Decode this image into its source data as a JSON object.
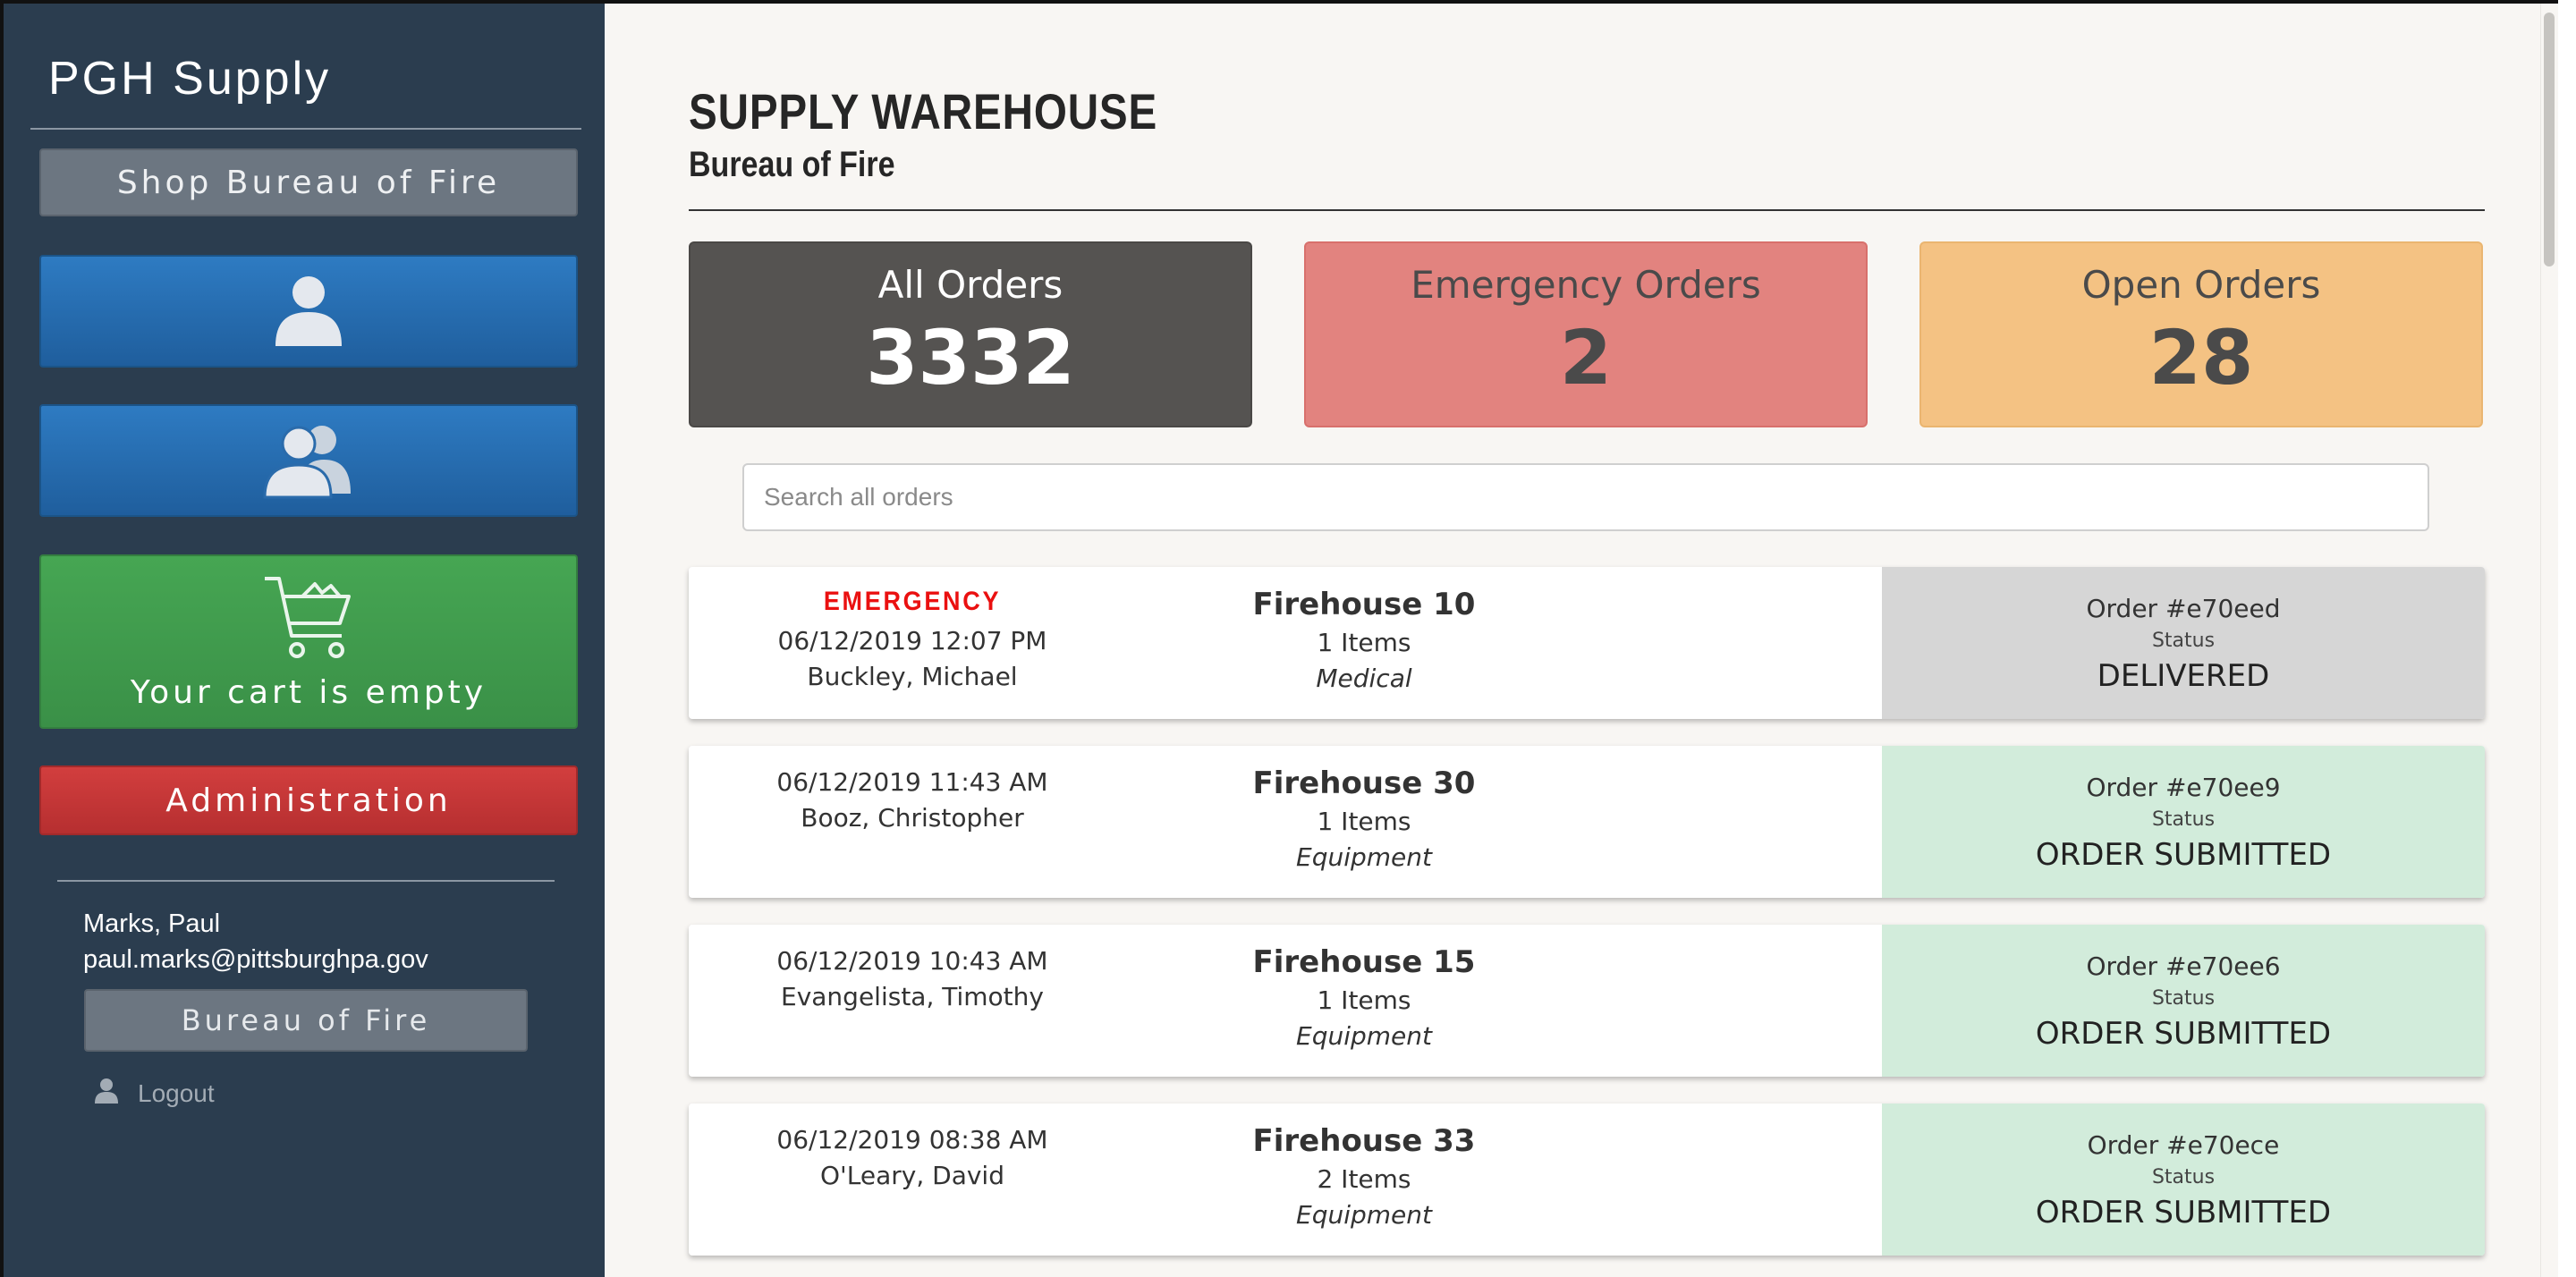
{
  "sidebar": {
    "brand": "PGH Supply",
    "shop_label": "Shop Bureau of Fire",
    "cart_label": "Your cart is empty",
    "admin_label": "Administration",
    "user": {
      "name": "Marks, Paul",
      "email": "paul.marks@pittsburghpa.gov",
      "department": "Bureau of Fire"
    },
    "logout_label": "Logout",
    "icons": [
      "person-icon",
      "people-icon",
      "cart-icon",
      "logout-person-icon"
    ]
  },
  "header": {
    "title": "SUPPLY WAREHOUSE",
    "subtitle": "Bureau of Fire"
  },
  "stats": {
    "all": {
      "label": "All Orders",
      "value": "3332"
    },
    "emergency": {
      "label": "Emergency Orders",
      "value": "2"
    },
    "open": {
      "label": "Open Orders",
      "value": "28"
    }
  },
  "search": {
    "placeholder": "Search all orders",
    "value": ""
  },
  "orders": [
    {
      "emergency": "EMERGENCY",
      "date": "06/12/2019 12:07 PM",
      "name": "Buckley, Michael",
      "house": "Firehouse 10",
      "items": "1 Items",
      "category": "Medical",
      "order_no": "Order #e70eed",
      "status_label": "Status",
      "status": "DELIVERED"
    },
    {
      "date": "06/12/2019 11:43 AM",
      "name": "Booz, Christopher",
      "house": "Firehouse 30",
      "items": "1 Items",
      "category": "Equipment",
      "order_no": "Order #e70ee9",
      "status_label": "Status",
      "status": "ORDER SUBMITTED"
    },
    {
      "date": "06/12/2019 10:43 AM",
      "name": "Evangelista, Timothy",
      "house": "Firehouse 15",
      "items": "1 Items",
      "category": "Equipment",
      "order_no": "Order #e70ee6",
      "status_label": "Status",
      "status": "ORDER SUBMITTED"
    },
    {
      "date": "06/12/2019 08:38 AM",
      "name": "O'Leary, David",
      "house": "Firehouse 33",
      "items": "2 Items",
      "category": "Equipment",
      "order_no": "Order #e70ece",
      "status_label": "Status",
      "status": "ORDER SUBMITTED"
    }
  ],
  "colors": {
    "sidebar_bg": "#2b3d4f",
    "primary_blue": "#2667a8",
    "success_green": "#42a04f",
    "danger_red": "#c73637",
    "emergency_text": "#ea1010",
    "delivered_bg": "#d6d6d6",
    "submitted_bg": "#d2ecdb"
  }
}
